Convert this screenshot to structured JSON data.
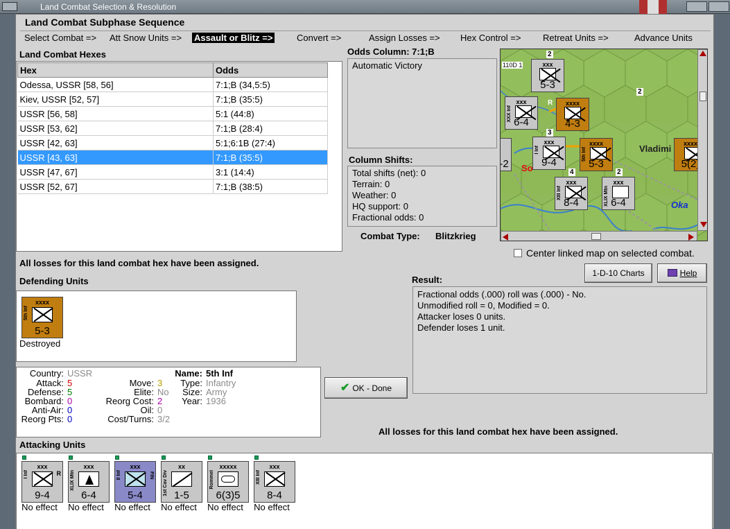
{
  "window": {
    "title": "Land Combat Selection & Resolution"
  },
  "sequence": {
    "heading": "Land Combat Subphase Sequence",
    "steps": [
      "Select Combat =>",
      "Att Snow Units =>",
      "Assault or Blitz =>",
      "Convert =>",
      "Assign Losses =>",
      "Hex Control =>",
      "Retreat Units =>",
      "Advance Units"
    ],
    "active_index": 2
  },
  "hexes": {
    "heading": "Land Combat Hexes",
    "columns": [
      "Hex",
      "Odds"
    ],
    "rows": [
      [
        "Odessa, USSR [58, 56]",
        "7:1;B (34,5:5)"
      ],
      [
        "Kiev, USSR [52, 57]",
        "7:1;B (35:5)"
      ],
      [
        "USSR [56, 58]",
        "5:1 (44:8)"
      ],
      [
        "USSR [53, 62]",
        "7:1;B (28:4)"
      ],
      [
        "USSR [42, 63]",
        "5:1;6:1B (27:4)"
      ],
      [
        "USSR [43, 63]",
        "7:1;B (35:5)"
      ],
      [
        "USSR [47, 67]",
        "3:1 (14:4)"
      ],
      [
        "USSR [52, 67]",
        "7:1;B (38:5)"
      ]
    ],
    "selected_index": 5
  },
  "odds": {
    "heading": "Odds Column: 7:1;B",
    "text": "Automatic Victory"
  },
  "shifts": {
    "heading": "Column Shifts:",
    "lines": [
      "Total shifts (net): 0",
      "Terrain: 0",
      "Weather: 0",
      "HQ support: 0",
      "Fractional odds: 0"
    ]
  },
  "combat_type": {
    "label": "Combat Type:",
    "value": "Blitzkrieg"
  },
  "map": {
    "place_labels": [
      "Vladimi",
      "Oka",
      "So"
    ],
    "hex_labels": [
      "110D 1",
      "2",
      "2",
      "R",
      "3",
      "R",
      "4",
      "2",
      "R"
    ],
    "counters": [
      {
        "size": "xxx",
        "value": "5-3",
        "color": "gray",
        "side": "",
        "tag": ""
      },
      {
        "size": "xxx",
        "value": "6-4",
        "color": "gray",
        "side": "XXX Inf",
        "tag": ""
      },
      {
        "size": "xxxx",
        "value": "4-3",
        "color": "brown",
        "side": "",
        "tag": ""
      },
      {
        "size": "xxx",
        "value": "9-4",
        "color": "gray",
        "side": "I Inf",
        "tag": ""
      },
      {
        "size": "xxxx",
        "value": "5-3",
        "color": "brown",
        "side": "5th Inf",
        "tag": ""
      },
      {
        "size": "xxx",
        "value": "8-4",
        "color": "gray",
        "side": "XIII Inf",
        "tag": ""
      },
      {
        "size": "xxx",
        "value": "6-4",
        "color": "gray",
        "side": "XLIX Mtn",
        "tag": ""
      },
      {
        "size": "xxxx",
        "value": "5(2)",
        "color": "brown",
        "side": "",
        "tag": ""
      },
      {
        "size": "",
        "value": "-2",
        "color": "gray",
        "side": "",
        "tag": ""
      }
    ]
  },
  "center_linked": "Center linked map on selected combat.",
  "losses_msg": "All losses for this land combat hex have been assigned.",
  "buttons": {
    "charts": "1-D-10 Charts",
    "help": "Help",
    "ok": "OK - Done"
  },
  "defending": {
    "heading": "Defending Units",
    "units": [
      {
        "size": "xxxx",
        "side": "5th Inf",
        "value": "5-3",
        "color": "brown",
        "status": "Destroyed"
      }
    ]
  },
  "result": {
    "heading": "Result:",
    "lines": [
      "Fractional odds (.000) roll was (.000)  - No.",
      "Unmodified roll = 0, Modified = 0.",
      "Attacker loses 0 units.",
      "Defender loses 1 unit."
    ]
  },
  "unit_info": {
    "col1": [
      {
        "label": "Country:",
        "value": "USSR",
        "color": "#8a8a8a"
      },
      {
        "label": "Attack:",
        "value": "5",
        "color": "#d00000"
      },
      {
        "label": "Defense:",
        "value": "5",
        "color": "#008000"
      },
      {
        "label": "Bombard:",
        "value": "0",
        "color": "#b000b0"
      },
      {
        "label": "Anti-Air:",
        "value": "0",
        "color": "#0000c0"
      },
      {
        "label": "Reorg Pts:",
        "value": "0",
        "color": "#0000c0"
      }
    ],
    "col2": [
      {
        "label": "Move:",
        "value": "3",
        "color": "#b8a000"
      },
      {
        "label": "Elite:",
        "value": "No",
        "color": "#8a8a8a"
      },
      {
        "label": "Reorg Cost:",
        "value": "2",
        "color": "#b000b0"
      },
      {
        "label": "Oil:",
        "value": "0",
        "color": "#8a8a8a"
      },
      {
        "label": "Cost/Turns:",
        "value": "3/2",
        "color": "#8a8a8a"
      }
    ],
    "col3": [
      {
        "label": "Name:",
        "value": "5th Inf",
        "color": "#000000"
      },
      {
        "label": "Type:",
        "value": "Infantry",
        "color": "#8a8a8a"
      },
      {
        "label": "Size:",
        "value": "Army",
        "color": "#8a8a8a"
      },
      {
        "label": "Year:",
        "value": "1936",
        "color": "#8a8a8a"
      }
    ]
  },
  "attacking": {
    "heading": "Attacking Units",
    "units": [
      {
        "size": "xxx",
        "side": "I Inf",
        "value": "9-4",
        "color": "gray",
        "tag": "R",
        "status": "No effect"
      },
      {
        "size": "xxx",
        "side": "XLIX Mtn",
        "value": "6-4",
        "color": "gray",
        "tag": "",
        "status": "No effect"
      },
      {
        "size": "xxx",
        "side": "II Inf",
        "value": "5-4",
        "color": "blue",
        "tag": "FIN",
        "status": "No effect"
      },
      {
        "size": "xx",
        "side": "1st Cav Div",
        "value": "1-5",
        "color": "gray",
        "tag": "",
        "status": "No effect"
      },
      {
        "size": "xxxxx",
        "side": "Rommel",
        "value": "6(3)5",
        "color": "gray",
        "tag": "",
        "status": "No effect"
      },
      {
        "size": "xxx",
        "side": "XIII Inf",
        "value": "8-4",
        "color": "gray",
        "tag": "",
        "status": "No effect"
      }
    ]
  }
}
